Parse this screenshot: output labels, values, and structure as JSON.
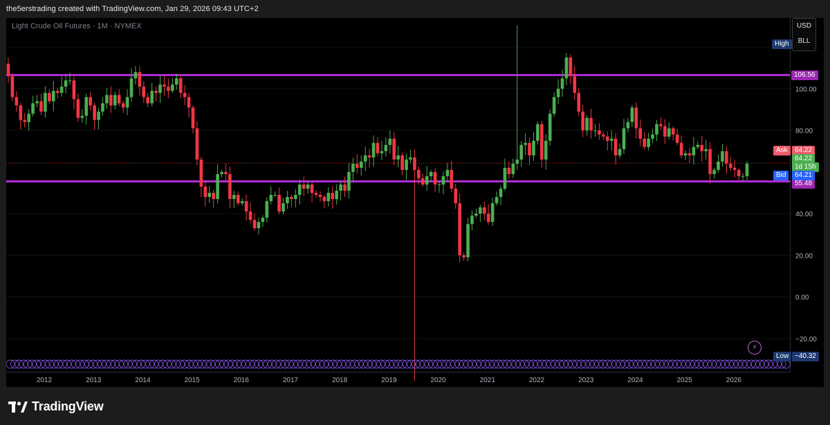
{
  "header": {
    "text": "the5erstrading created with TradingView.com, Jan 29, 2026 09:43 UTC+2"
  },
  "legend": {
    "symbol": "Light Crude Oil Futures · 1M · NYMEX"
  },
  "unit_box": {
    "currency": "USD",
    "unit": "BLL"
  },
  "labels": {
    "high": "High",
    "low": "Low",
    "low_value": "−40.32",
    "ask": "Ask",
    "ask_value": "64.22",
    "bid": "Bid",
    "bid_value": "64.21",
    "last_value": "64.22",
    "countdown": "1d 15h",
    "resistance_value": "106.56",
    "support_value": "55.48"
  },
  "footer": {
    "brand": "TradingView"
  },
  "colors": {
    "bull": "#4caf50",
    "bear": "#f23645",
    "level_line": "#b32cd8",
    "ask_tag": "#f05a6a",
    "bid_tag": "#2962ff",
    "hl_tag": "#1e3a70",
    "level_tag": "#9c27b0"
  },
  "chart_data": {
    "type": "candlestick",
    "title": "Light Crude Oil Futures · 1M · NYMEX",
    "ylim": [
      -32,
      134
    ],
    "y_ticks": [
      120,
      100,
      80,
      40,
      20,
      0,
      -20
    ],
    "y_tick_labels": [
      "120.00",
      "100.00",
      "80.00",
      "40.00",
      "20.00",
      "0.00",
      "−20.00"
    ],
    "x_ticks": [
      "2012",
      "2013",
      "2014",
      "2015",
      "2016",
      "2017",
      "2018",
      "2019",
      "2020",
      "2021",
      "2022",
      "2023",
      "2024",
      "2025",
      "2026"
    ],
    "horizontal_levels": [
      106.56,
      55.48
    ],
    "current_price": 64.22,
    "grid": true,
    "monthly_close": [
      106,
      96,
      92,
      85,
      84,
      88,
      93,
      94,
      89,
      98,
      94,
      99,
      98,
      101,
      104,
      104,
      95,
      86,
      87,
      96,
      92,
      85,
      89,
      93,
      97,
      92,
      97,
      93,
      91,
      96,
      105,
      108,
      101,
      96,
      93,
      99,
      98,
      102,
      101,
      99,
      102,
      105,
      98,
      96,
      91,
      81,
      66,
      53,
      48,
      50,
      47,
      59,
      60,
      59,
      47,
      49,
      45,
      46,
      41,
      37,
      33,
      36,
      38,
      46,
      49,
      49,
      41,
      45,
      48,
      47,
      49,
      54,
      52,
      54,
      50,
      49,
      48,
      46,
      50,
      47,
      51,
      54,
      51,
      60,
      64,
      62,
      65,
      68,
      67,
      74,
      69,
      70,
      73,
      76,
      66,
      68,
      61,
      66,
      67,
      61,
      57,
      54,
      58,
      60,
      54,
      54,
      58,
      61,
      52,
      45,
      20,
      19,
      35,
      39,
      40,
      43,
      40,
      36,
      45,
      48,
      52,
      62,
      59,
      64,
      66,
      73,
      74,
      68,
      75,
      83,
      66,
      75,
      88,
      96,
      100,
      105,
      115,
      106,
      98,
      89,
      80,
      86,
      80,
      80,
      78,
      77,
      75,
      76,
      68,
      71,
      81,
      84,
      91,
      81,
      76,
      72,
      76,
      78,
      83,
      82,
      77,
      81,
      78,
      74,
      68,
      69,
      68,
      72,
      73,
      70,
      71,
      59,
      61,
      65,
      70,
      64,
      62,
      61,
      58,
      58,
      64
    ]
  }
}
